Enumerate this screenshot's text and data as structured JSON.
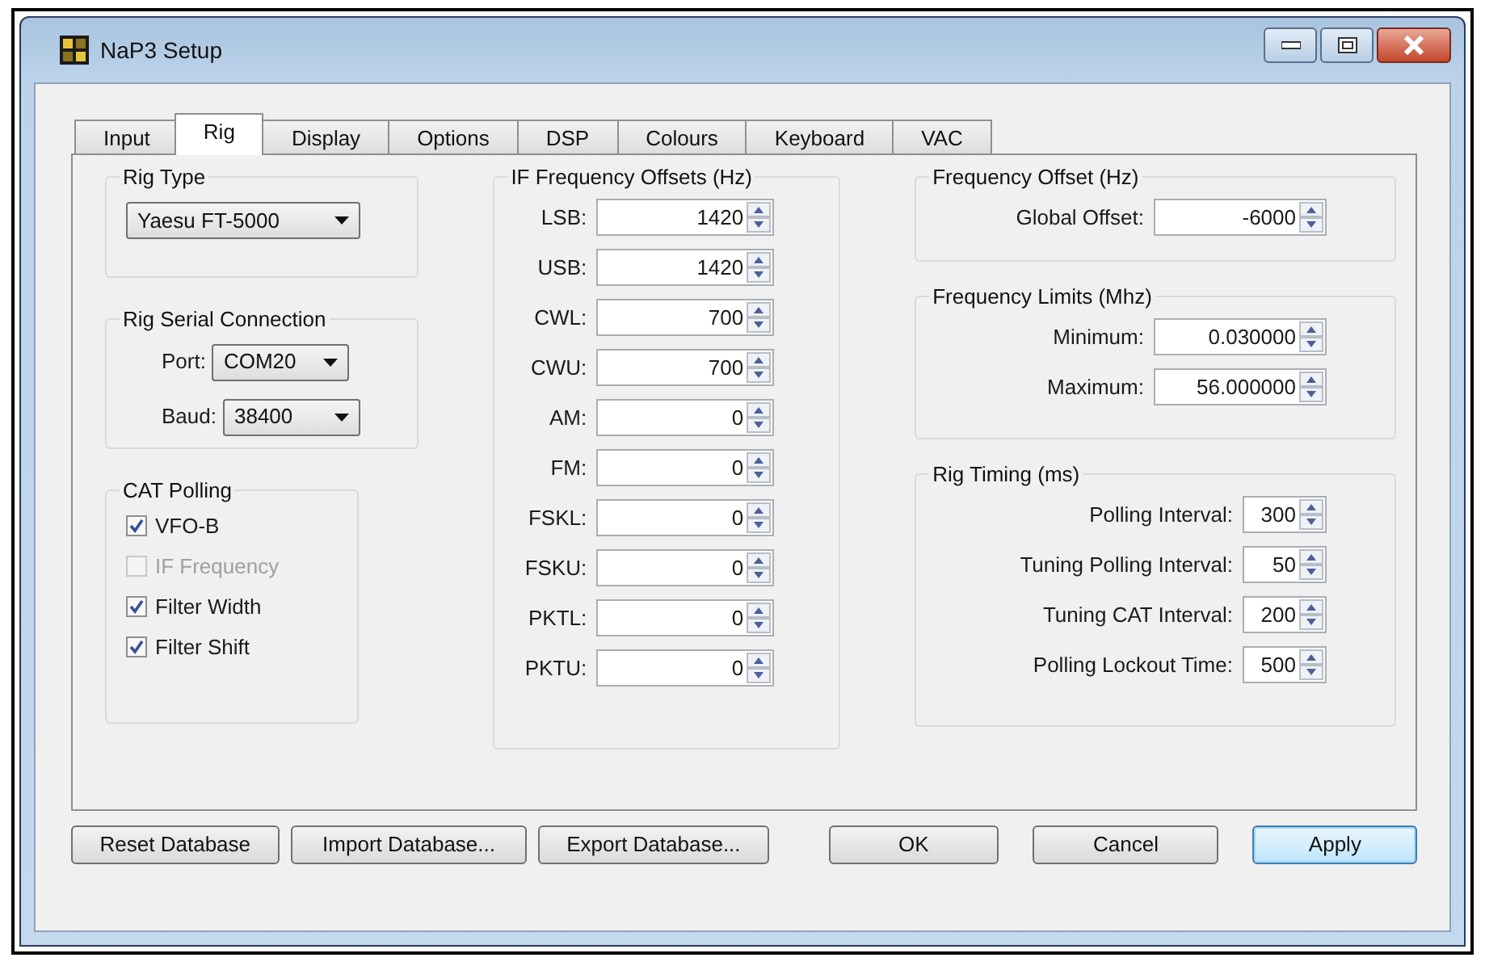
{
  "window": {
    "title": "NaP3 Setup"
  },
  "tabs": [
    {
      "label": "Input",
      "selected": false
    },
    {
      "label": "Rig",
      "selected": true
    },
    {
      "label": "Display",
      "selected": false
    },
    {
      "label": "Options",
      "selected": false
    },
    {
      "label": "DSP",
      "selected": false
    },
    {
      "label": "Colours",
      "selected": false
    },
    {
      "label": "Keyboard",
      "selected": false
    },
    {
      "label": "VAC",
      "selected": false
    }
  ],
  "rig_type": {
    "title": "Rig Type",
    "value": "Yaesu FT-5000"
  },
  "rig_serial_connection": {
    "title": "Rig Serial Connection",
    "fields": [
      {
        "label": "Port:",
        "value": "COM20"
      },
      {
        "label": "Baud:",
        "value": "38400"
      }
    ]
  },
  "cat_polling": {
    "title": "CAT Polling",
    "items": [
      {
        "label": "VFO-B",
        "checked": true,
        "disabled": false
      },
      {
        "label": "IF Frequency",
        "checked": false,
        "disabled": true
      },
      {
        "label": "Filter Width",
        "checked": true,
        "disabled": false
      },
      {
        "label": "Filter Shift",
        "checked": true,
        "disabled": false
      }
    ]
  },
  "if_frequency_offsets": {
    "title": "IF Frequency Offsets (Hz)",
    "rows": [
      {
        "label": "LSB:",
        "value": "1420"
      },
      {
        "label": "USB:",
        "value": "1420"
      },
      {
        "label": "CWL:",
        "value": "700"
      },
      {
        "label": "CWU:",
        "value": "700"
      },
      {
        "label": "AM:",
        "value": "0"
      },
      {
        "label": "FM:",
        "value": "0"
      },
      {
        "label": "FSKL:",
        "value": "0"
      },
      {
        "label": "FSKU:",
        "value": "0"
      },
      {
        "label": "PKTL:",
        "value": "0"
      },
      {
        "label": "PKTU:",
        "value": "0"
      }
    ]
  },
  "frequency_offset": {
    "title": "Frequency Offset  (Hz)",
    "rows": [
      {
        "label": "Global Offset:",
        "value": "-6000"
      }
    ]
  },
  "frequency_limits": {
    "title": "Frequency Limits (Mhz)",
    "rows": [
      {
        "label": "Minimum:",
        "value": "0.030000"
      },
      {
        "label": "Maximum:",
        "value": "56.000000"
      }
    ]
  },
  "rig_timing": {
    "title": "Rig Timing (ms)",
    "rows": [
      {
        "label": "Polling Interval:",
        "value": "300"
      },
      {
        "label": "Tuning Polling Interval:",
        "value": "50"
      },
      {
        "label": "Tuning CAT Interval:",
        "value": "200"
      },
      {
        "label": "Polling Lockout Time:",
        "value": "500"
      }
    ]
  },
  "buttons": [
    {
      "label": "Reset Database",
      "focused": false
    },
    {
      "label": "Import Database...",
      "focused": false
    },
    {
      "label": "Export Database...",
      "focused": false
    },
    {
      "label": "OK",
      "focused": false
    },
    {
      "label": "Cancel",
      "focused": false
    },
    {
      "label": "Apply",
      "focused": true
    }
  ]
}
